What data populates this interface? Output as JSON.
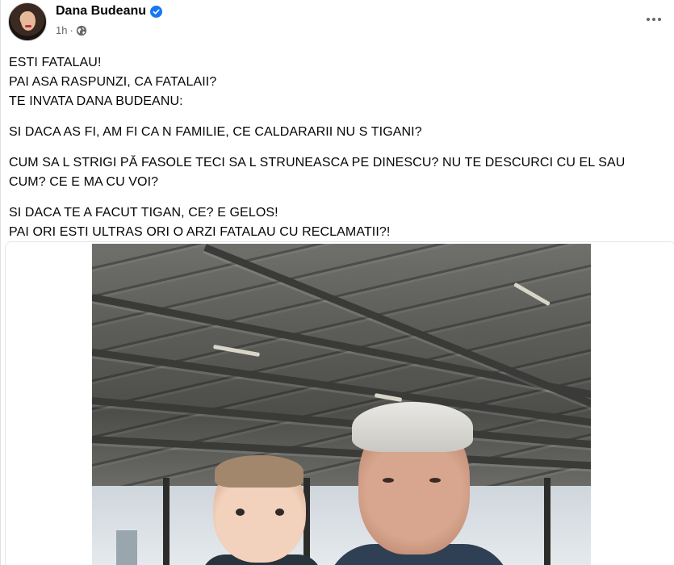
{
  "post": {
    "author": "Dana Budeanu",
    "time": "1h",
    "separator": "·",
    "paragraphs": [
      [
        "ESTI FATALAU!",
        "PAI ASA RASPUNZI, CA FATALAII?",
        "TE INVATA DANA BUDEANU:"
      ],
      [
        "SI DACA AS FI, AM FI CA N FAMILIE, CE CALDARARII NU S TIGANI?"
      ],
      [
        "CUM SA L STRIGI PĂ FASOLE TECI SA L STRUNEASCA PE DINESCU? NU TE DESCURCI CU EL SAU CUM? CE E MA CU VOI?"
      ],
      [
        "SI DACA TE A FACUT TIGAN, CE? E GELOS!",
        "PAI ORI ESTI ULTRAS ORI O ARZI FATALAU CU RECLAMATII?!"
      ]
    ]
  },
  "icons": {
    "verified": "verified-badge-icon",
    "audience": "globe-icon",
    "more": "more-options-icon"
  },
  "colors": {
    "verified": "#1877f2",
    "meta_text": "#65676b",
    "text": "#050505"
  }
}
